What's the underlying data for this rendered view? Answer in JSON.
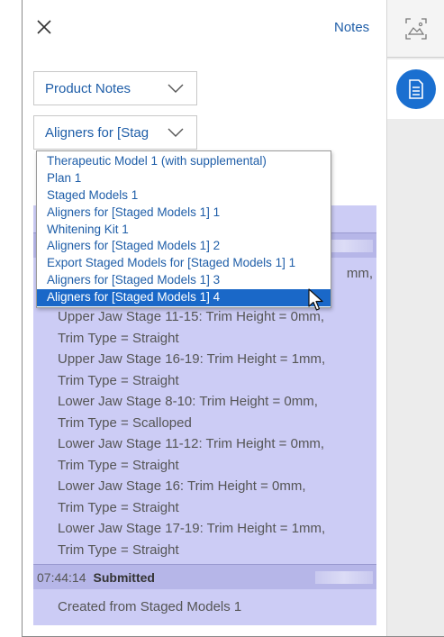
{
  "header": {
    "notes_link": "Notes"
  },
  "product_select": {
    "value": "Product Notes"
  },
  "stage_select": {
    "value": "Aligners for [Stag"
  },
  "dropdown": {
    "options": [
      "Therapeutic Model 1 (with supplemental)",
      "Plan 1",
      "Staged Models 1",
      "Aligners for [Staged Models 1] 1",
      "Whitening Kit 1",
      "Aligners for [Staged Models 1] 2",
      "Export Staged Models for [Staged Models 1] 1",
      "Aligners for [Staged Models 1] 3",
      "Aligners for [Staged Models 1] 4"
    ],
    "selected_index": 8
  },
  "entries": {
    "first": {
      "peek_text": "mm,",
      "lines": [
        "Upper Jaw Stage 11-15: Trim Height = 0mm,",
        "Trim Type = Straight",
        "Upper Jaw Stage 16-19: Trim Height = 1mm,",
        "Trim Type = Straight",
        "Lower Jaw Stage 8-10: Trim Height = 0mm,",
        "Trim Type = Scalloped",
        "Lower Jaw Stage 11-12: Trim Height = 0mm,",
        "Trim Type = Straight",
        "Lower Jaw Stage 16: Trim Height = 0mm,",
        "Trim Type = Straight",
        "Lower Jaw Stage 17-19: Trim Height = 1mm,",
        "Trim Type = Straight"
      ]
    },
    "second": {
      "time": "07:44:14",
      "status": "Submitted",
      "body": "Created from Staged Models 1"
    }
  },
  "icons": {
    "close": "close-icon",
    "rail_top": "image-scan-icon",
    "rail_doc": "document-icon",
    "chevron": "chevron-down-icon",
    "cursor": "mouse-pointer-icon"
  },
  "colors": {
    "accent": "#1a68c8",
    "link": "#1f5ea8",
    "panel": "#ccccf5",
    "panel_header": "#b6b6e8"
  }
}
